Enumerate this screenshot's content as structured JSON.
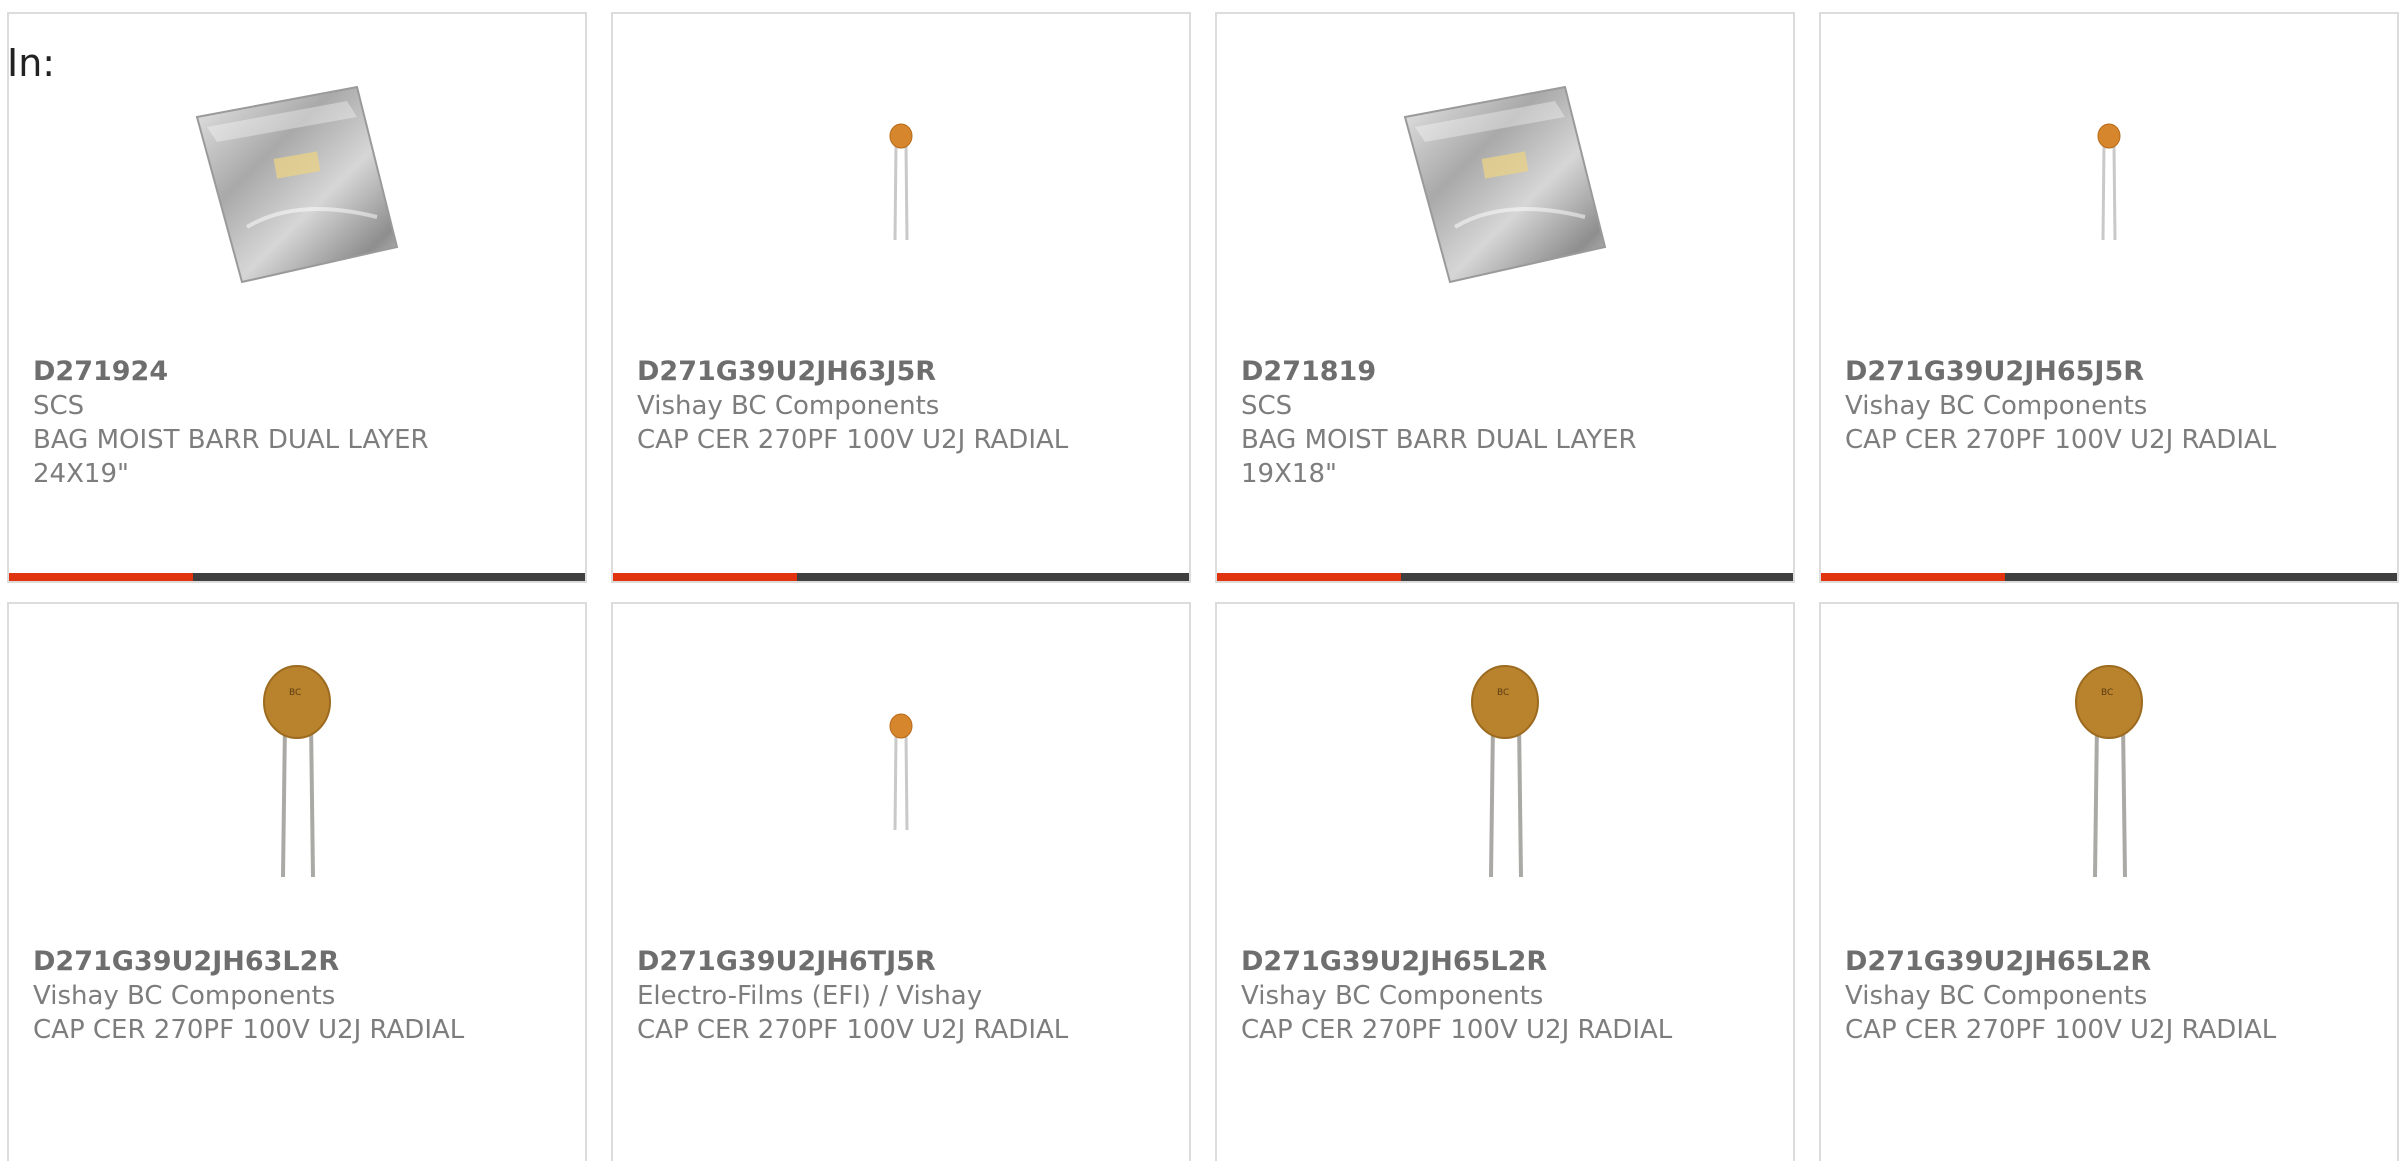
{
  "header": {
    "in_label": "In:"
  },
  "colors": {
    "accent": "#e0340f",
    "bar_track": "#3f3f3f",
    "card_border": "#dcdcdc",
    "text_gray": "#7d7d7d"
  },
  "products": [
    {
      "part_number": "D271924",
      "manufacturer": "SCS",
      "description": "BAG MOIST BARR DUAL LAYER 24X19\"",
      "image_icon": "moisture-barrier-bag-icon",
      "progress": 0.32
    },
    {
      "part_number": "D271G39U2JH63J5R",
      "manufacturer": "Vishay BC Components",
      "description": "CAP CER 270PF 100V U2J RADIAL",
      "image_icon": "small-ceramic-capacitor-icon",
      "progress": 0.32
    },
    {
      "part_number": "D271819",
      "manufacturer": "SCS",
      "description": "BAG MOIST BARR DUAL LAYER 19X18\"",
      "image_icon": "moisture-barrier-bag-icon",
      "progress": 0.32
    },
    {
      "part_number": "D271G39U2JH65J5R",
      "manufacturer": "Vishay BC Components",
      "description": "CAP CER 270PF 100V U2J RADIAL",
      "image_icon": "small-ceramic-capacitor-icon",
      "progress": 0.32
    },
    {
      "part_number": "D271G39U2JH63L2R",
      "manufacturer": "Vishay BC Components",
      "description": "CAP CER 270PF 100V U2J RADIAL",
      "image_icon": "large-ceramic-capacitor-icon"
    },
    {
      "part_number": "D271G39U2JH6TJ5R",
      "manufacturer": "Electro-Films (EFI) / Vishay",
      "description": "CAP CER 270PF 100V U2J RADIAL",
      "image_icon": "small-ceramic-capacitor-icon"
    },
    {
      "part_number": "D271G39U2JH65L2R",
      "manufacturer": "Vishay BC Components",
      "description": "CAP CER 270PF 100V U2J RADIAL",
      "image_icon": "large-ceramic-capacitor-icon"
    },
    {
      "part_number": "D271G39U2JH65L2R",
      "manufacturer": "Vishay BC Components",
      "description": "CAP CER 270PF 100V U2J RADIAL",
      "image_icon": "large-ceramic-capacitor-icon"
    }
  ]
}
